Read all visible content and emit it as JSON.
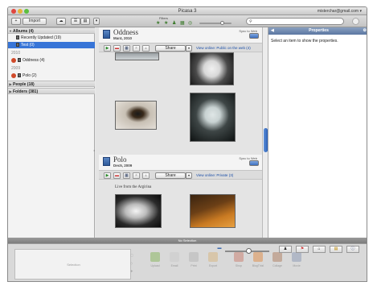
{
  "window": {
    "title": "Picasa 3",
    "user_menu": "misterchar@gmail.com ▾"
  },
  "toolbar": {
    "import_label": "Import",
    "filters_label": "Filters",
    "search_placeholder": ""
  },
  "sidebar": {
    "sections": [
      {
        "label": "Albums (4)"
      },
      {
        "label": "People (18)"
      },
      {
        "label": "Folders (381)"
      }
    ],
    "items": [
      {
        "label": "Recently Updated (19)"
      },
      {
        "label": "Test (0)"
      },
      {
        "label": "2010"
      },
      {
        "label": "Oddness (4)"
      },
      {
        "label": "2009"
      },
      {
        "label": "Polo (2)"
      }
    ]
  },
  "albums": [
    {
      "title": "Oddness",
      "date": "Mar4, 2010",
      "sync_label": "Sync to Web",
      "share_label": "Share",
      "view_online": "View online: Public on the web (4)",
      "caption": ""
    },
    {
      "title": "Polo",
      "date": "Dec5, 2009",
      "sync_label": "Sync to Web",
      "share_label": "Share",
      "view_online": "View online: Private (3)",
      "caption": "Live from the Argirina"
    }
  ],
  "properties": {
    "title": "Properties",
    "message": "Select an item to show the properties."
  },
  "status": {
    "text": "No Selection"
  },
  "tray": {
    "selection_label": "Selection",
    "actions": [
      {
        "label": "Upload"
      },
      {
        "label": "Email"
      },
      {
        "label": "Print"
      },
      {
        "label": "Export"
      },
      {
        "label": "Shop"
      },
      {
        "label": "BlogThis!"
      },
      {
        "label": "Collage"
      },
      {
        "label": "Movie"
      }
    ]
  },
  "colors": {
    "selected": "#3875d7",
    "link": "#1a4ea8",
    "properties_header": "#5b77a2"
  }
}
